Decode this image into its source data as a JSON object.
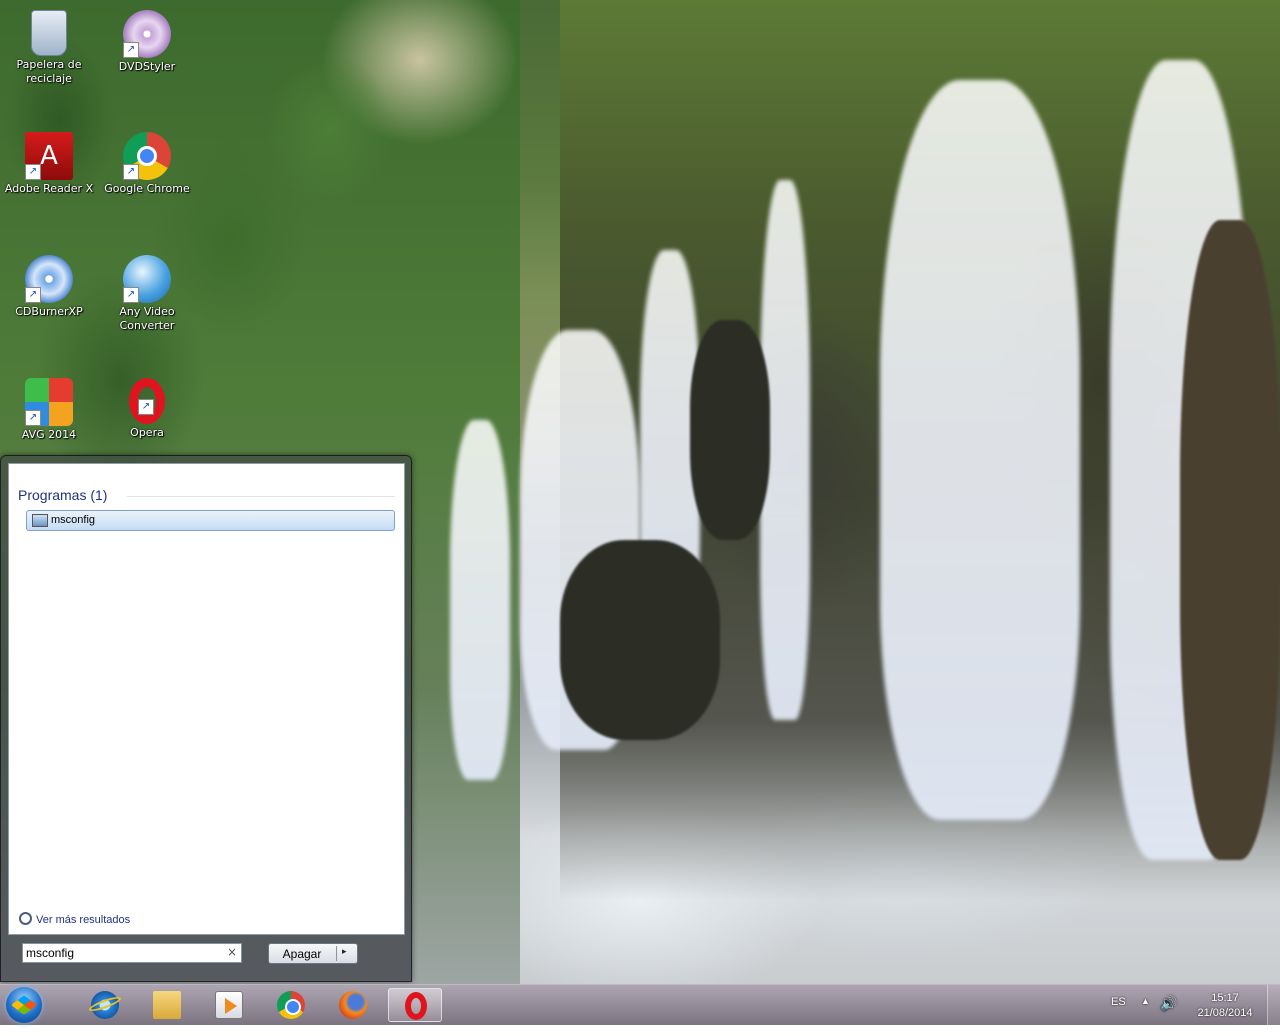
{
  "desktop": {
    "icons": [
      {
        "label": "Papelera de reciclaje",
        "icon": "recycle-bin-icon"
      },
      {
        "label": "DVDStyler",
        "icon": "dvdstyler-icon"
      },
      {
        "label": "Adobe Reader X",
        "icon": "adobe-reader-icon"
      },
      {
        "label": "Google Chrome",
        "icon": "chrome-icon"
      },
      {
        "label": "CDBurnerXP",
        "icon": "cdburnerxp-icon"
      },
      {
        "label": "Any Video Converter",
        "icon": "any-video-converter-icon"
      },
      {
        "label": "AVG 2014",
        "icon": "avg-icon"
      },
      {
        "label": "Opera",
        "icon": "opera-icon"
      }
    ]
  },
  "start_menu": {
    "group_label": "Programas (1)",
    "results": [
      {
        "label": "msconfig",
        "icon": "msconfig-icon"
      }
    ],
    "more_results": "Ver más resultados",
    "search_value": "msconfig",
    "clear_glyph": "×",
    "shutdown_label": "Apagar",
    "shutdown_arrow": "▸"
  },
  "taskbar": {
    "pinned": [
      {
        "name": "internet-explorer",
        "icon": "internet-explorer-icon"
      },
      {
        "name": "windows-explorer",
        "icon": "folder-icon"
      },
      {
        "name": "windows-media-player",
        "icon": "media-player-icon"
      },
      {
        "name": "google-chrome",
        "icon": "chrome-icon"
      },
      {
        "name": "firefox",
        "icon": "firefox-icon"
      },
      {
        "name": "opera",
        "icon": "opera-icon",
        "active": true
      }
    ],
    "language": "ES",
    "tray_arrow": "▲",
    "volume_glyph": "🔊",
    "time": "15:17",
    "date": "21/08/2014"
  }
}
